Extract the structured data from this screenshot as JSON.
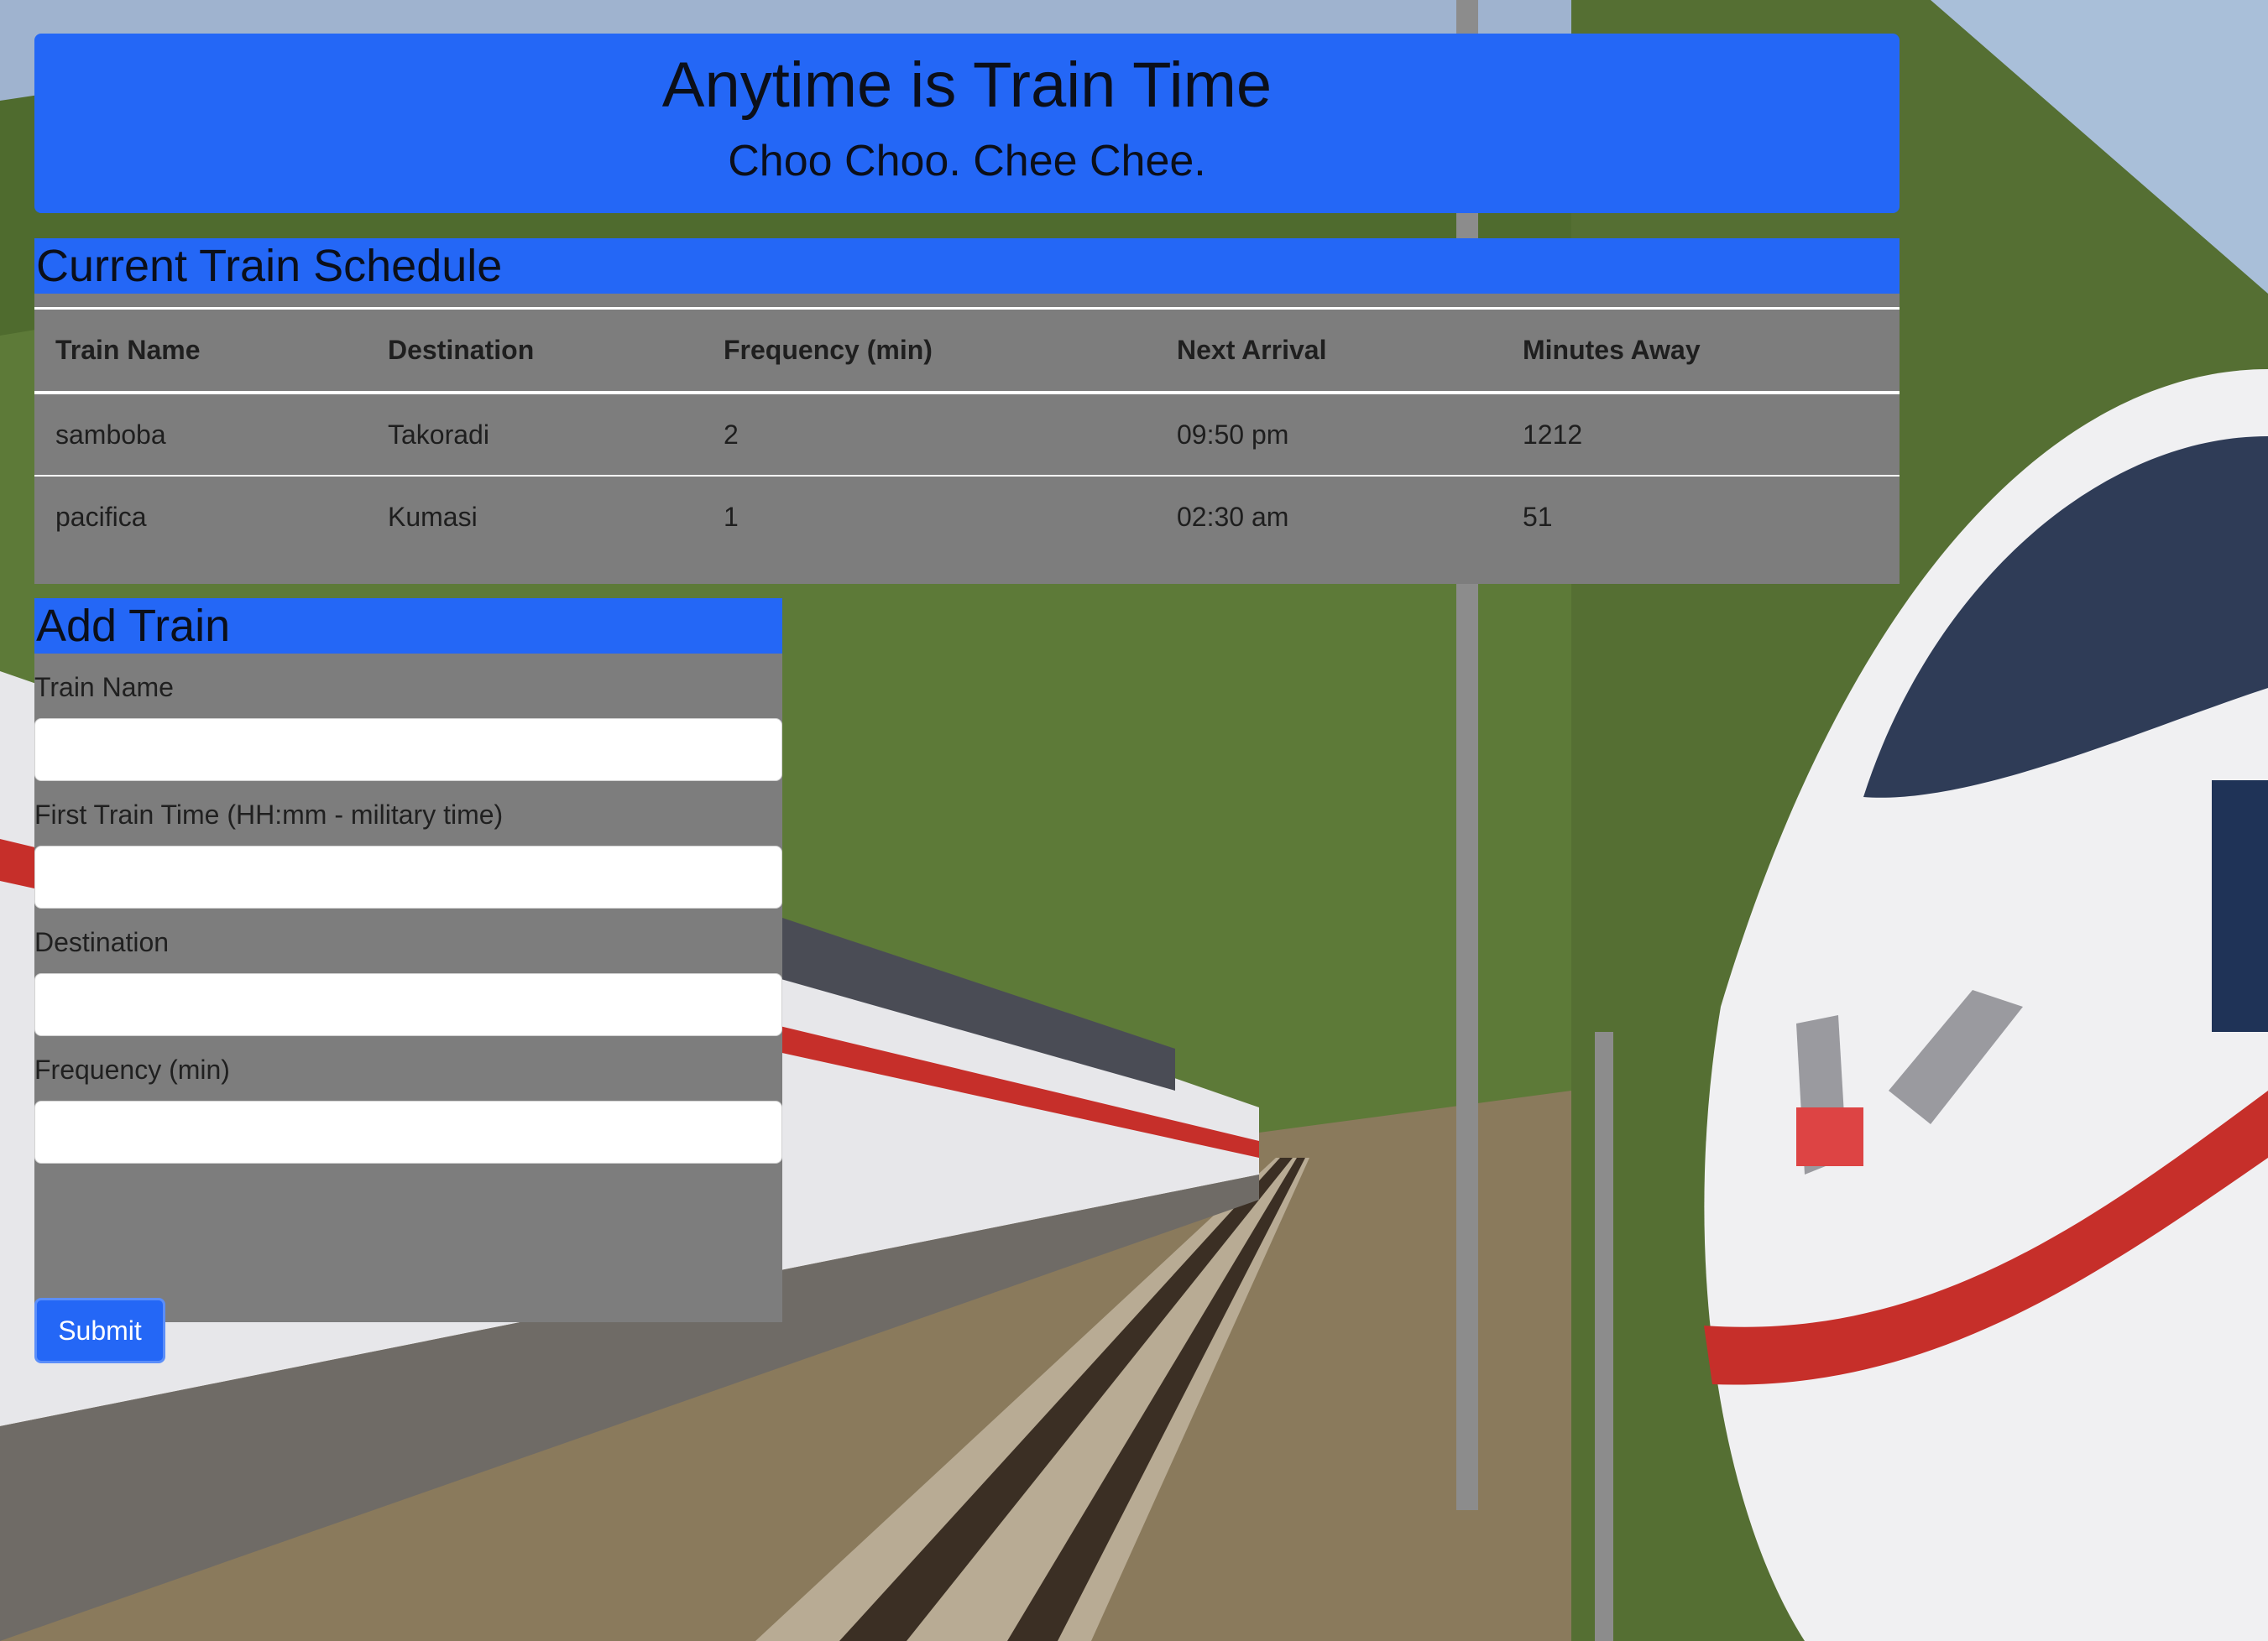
{
  "header": {
    "title": "Anytime is Train Time",
    "subtitle": "Choo Choo. Chee Chee."
  },
  "schedule": {
    "heading": "Current Train Schedule",
    "columns": [
      "Train Name",
      "Destination",
      "Frequency (min)",
      "Next Arrival",
      "Minutes Away"
    ],
    "rows": [
      [
        "samboba",
        "Takoradi",
        "2",
        "09:50 pm",
        "1212"
      ],
      [
        "pacifica",
        "Kumasi",
        "1",
        "02:30 am",
        "51"
      ]
    ]
  },
  "add_train": {
    "heading": "Add Train",
    "fields": [
      {
        "label": "Train Name",
        "value": "",
        "placeholder": ""
      },
      {
        "label": "First Train Time (HH:mm - military time)",
        "value": "",
        "placeholder": ""
      },
      {
        "label": "Destination",
        "value": "",
        "placeholder": ""
      },
      {
        "label": "Frequency (min)",
        "value": "",
        "placeholder": ""
      }
    ],
    "submit_label": "Submit"
  },
  "colors": {
    "accent": "#2467f6",
    "panel": "#7d7d7d"
  }
}
